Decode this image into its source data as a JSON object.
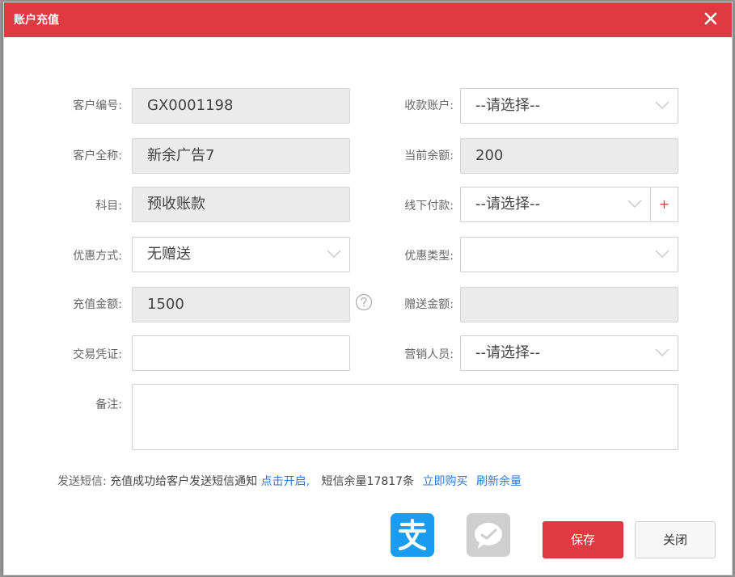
{
  "dialog": {
    "title": "账户充值",
    "colors": {
      "titlebar": "#df3a42",
      "link": "#2a7ad2"
    }
  },
  "form": {
    "customer_no": {
      "label": "客户编号:",
      "value": "GX0001198"
    },
    "receiving_account": {
      "label": "收款账户:",
      "value": "--请选择--"
    },
    "customer_name": {
      "label": "客户全称:",
      "value": "新余广告7"
    },
    "current_balance": {
      "label": "当前余额:",
      "value": "200"
    },
    "subject": {
      "label": "科目:",
      "value": "预收账款"
    },
    "offline_payment": {
      "label": "线下付款:",
      "value": "--请选择--",
      "add": "+"
    },
    "discount_method": {
      "label": "优惠方式:",
      "value": "无赠送"
    },
    "discount_type": {
      "label": "优惠类型:",
      "value": ""
    },
    "recharge_amount": {
      "label": "充值金额:",
      "value": "1500"
    },
    "gift_amount": {
      "label": "赠送金额:",
      "value": ""
    },
    "voucher": {
      "label": "交易凭证:",
      "value": ""
    },
    "sales_person": {
      "label": "营销人员:",
      "value": "--请选择--"
    },
    "remark": {
      "label": "备注:",
      "value": ""
    }
  },
  "sms": {
    "label": "发送短信:",
    "notice": "充值成功给客户发送短信通知",
    "enable_link": "点击开启,",
    "remaining": "短信余量17817条",
    "buy_link": "立即购买",
    "refresh_link": "刷新余量"
  },
  "footer": {
    "save_label": "保存",
    "close_label": "关闭",
    "icons": [
      "alipay-icon",
      "wechat-icon"
    ]
  }
}
